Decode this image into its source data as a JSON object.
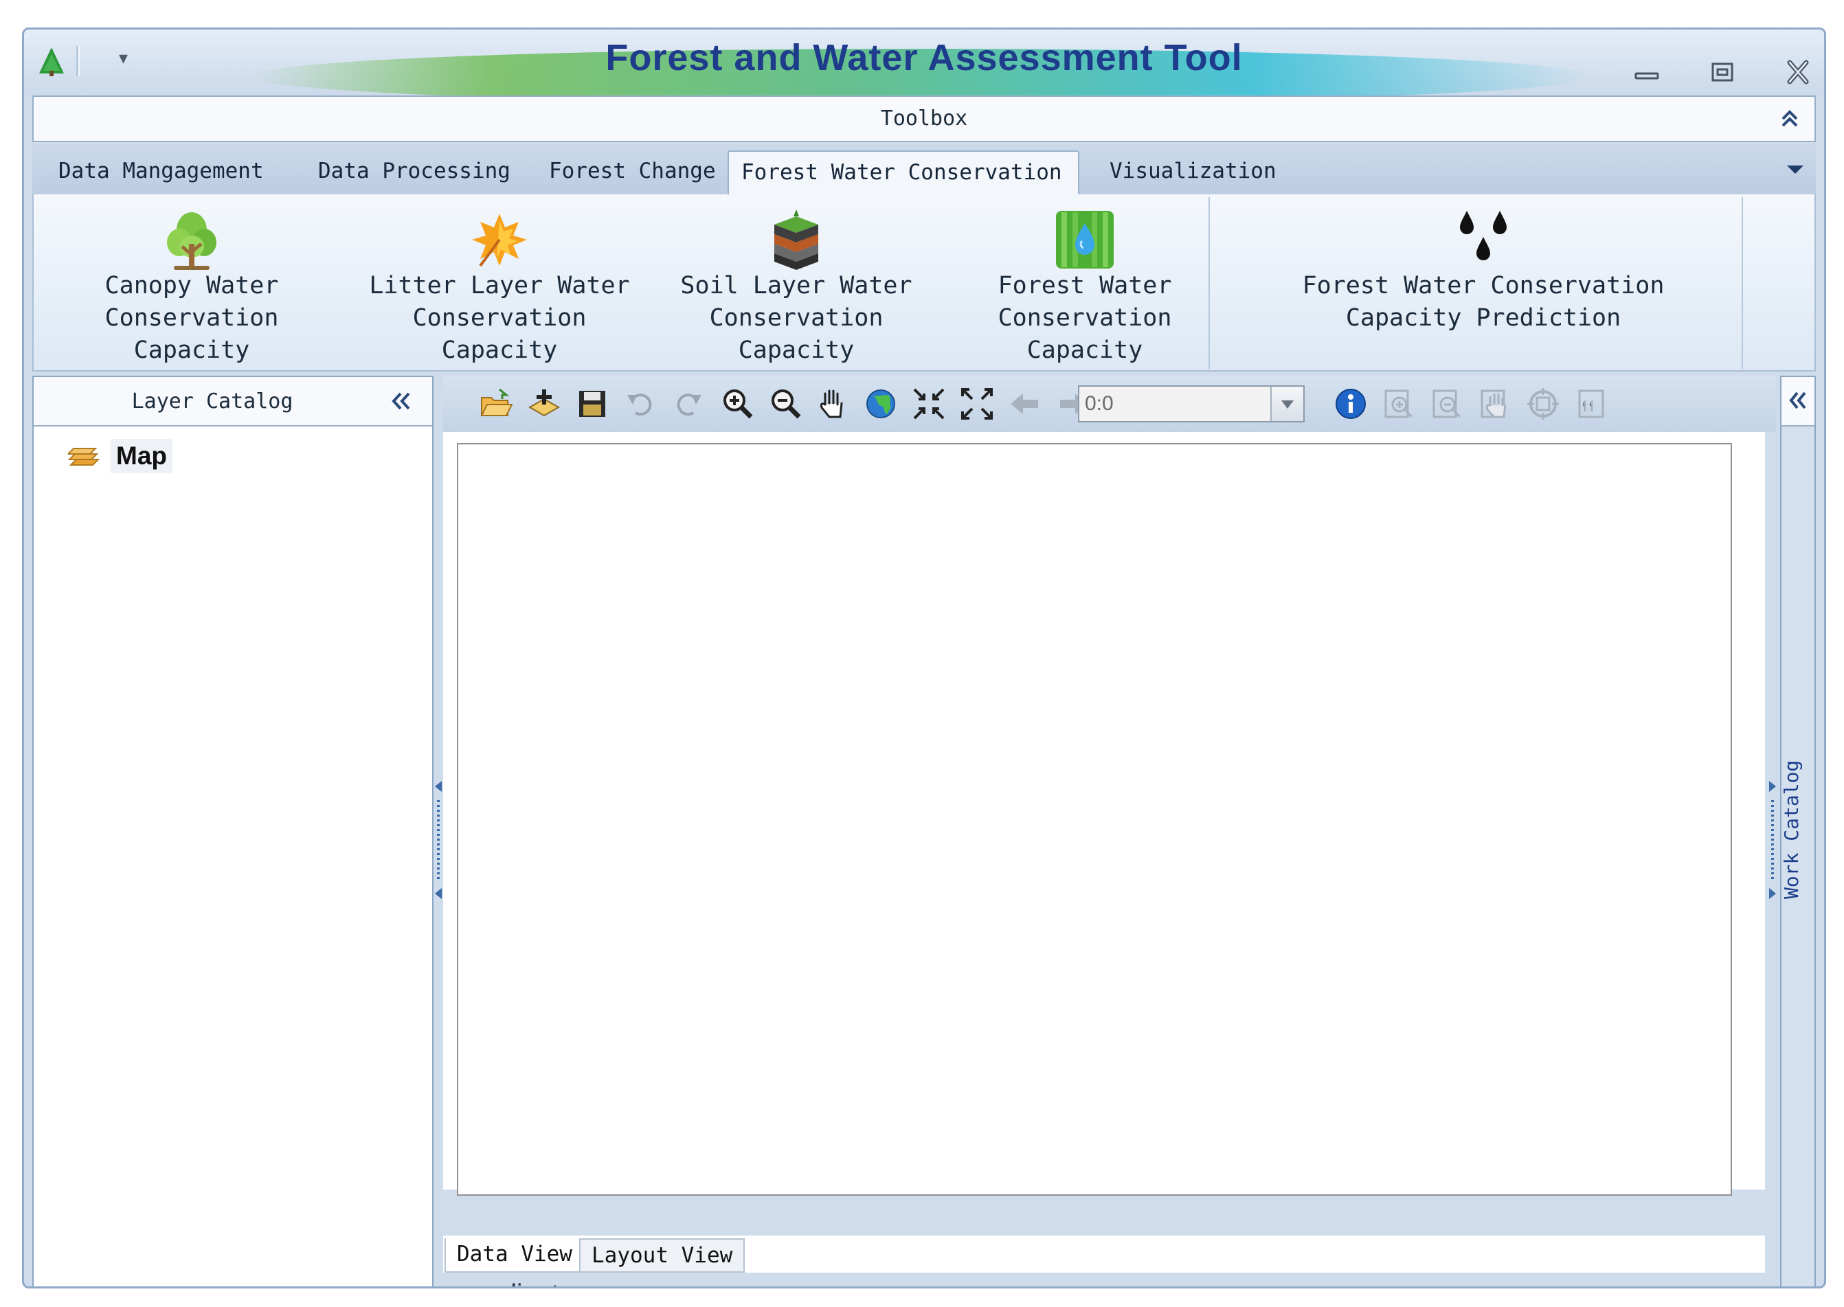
{
  "window": {
    "title": "Forest and Water Assessment Tool",
    "quick_access_dropdown": "▾"
  },
  "toolbox": {
    "title": "Toolbox"
  },
  "tabs": [
    {
      "label": "Data Mangagement",
      "active": false
    },
    {
      "label": "Data Processing",
      "active": false
    },
    {
      "label": "Forest Change",
      "active": false
    },
    {
      "label": "Forest Water Conservation",
      "active": true
    },
    {
      "label": "Visualization",
      "active": false
    }
  ],
  "ribbon_tools": [
    {
      "label": "Canopy Water\nConservation\nCapacity",
      "icon": "tree-icon"
    },
    {
      "label": "Litter Layer Water\nConservation\nCapacity",
      "icon": "leaf-icon"
    },
    {
      "label": "Soil Layer Water\nConservation\nCapacity",
      "icon": "soil-layers-icon"
    },
    {
      "label": "Forest Water\nConservation\nCapacity",
      "icon": "forest-water-drop-icon"
    },
    {
      "label": "Forest Water Conservation\nCapacity Prediction",
      "icon": "water-drops-icon"
    }
  ],
  "layer_catalog": {
    "title": "Layer Catalog",
    "items": [
      {
        "label": "Map",
        "icon": "layers-icon"
      }
    ]
  },
  "map_toolbar": {
    "scale_value": "0:0",
    "buttons": [
      "open-folder-icon",
      "add-data-icon",
      "save-icon",
      "undo-icon",
      "redo-icon",
      "zoom-in-icon",
      "zoom-out-icon",
      "pan-hand-icon",
      "full-extent-globe-icon",
      "fixed-zoom-in-icon",
      "fixed-zoom-out-icon",
      "previous-extent-icon",
      "next-extent-icon",
      "identify-icon",
      "layout-zoom-in-icon",
      "layout-zoom-out-icon",
      "layout-pan-icon",
      "layout-whole-page-icon",
      "layout-actual-size-icon"
    ]
  },
  "view_tabs": [
    {
      "label": "Data View",
      "active": true
    },
    {
      "label": "Layout View",
      "active": false
    }
  ],
  "status_bar": {
    "text": "coordinate"
  },
  "work_catalog": {
    "title": "Work Catalog"
  },
  "colors": {
    "title_text": "#1e3b8c",
    "frame": "#cfdcec",
    "accent_blue": "#1b3c8c"
  }
}
